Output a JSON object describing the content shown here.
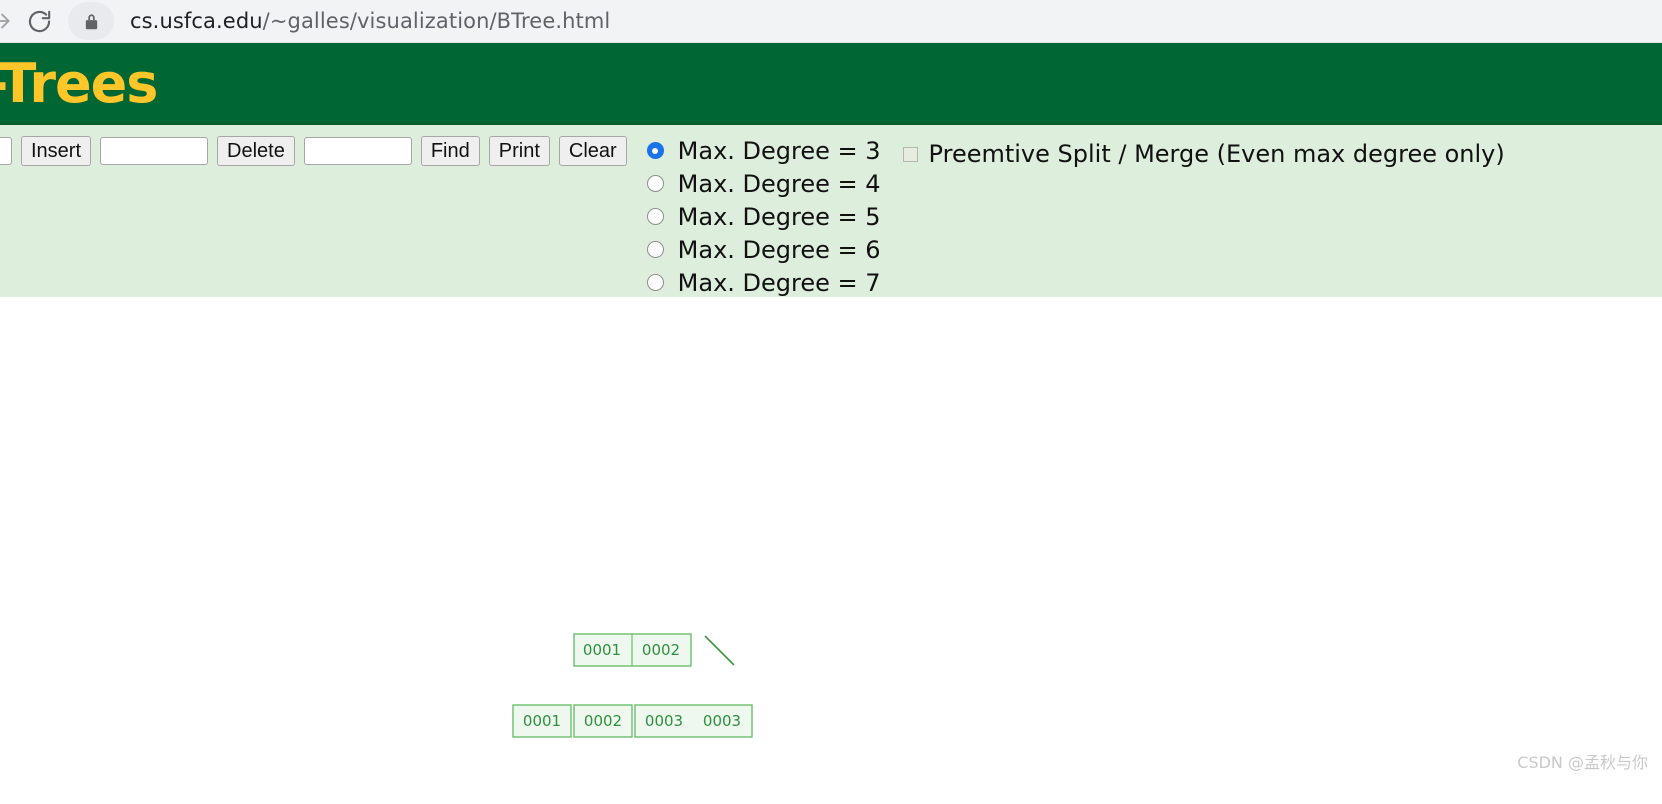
{
  "browser": {
    "forward_icon": "arrow-forward-icon",
    "reload_icon": "reload-icon",
    "lock_icon": "lock-icon",
    "url_host": "cs.usfca.edu",
    "url_path": "/~galles/visualization/BTree.html",
    "url_full": "cs.usfca.edu/~galles/visualization/BTree.html"
  },
  "page": {
    "title": "-Trees",
    "title_color": "#ffc629",
    "banner_color": "#006633",
    "controls_bg": "#ddeedd"
  },
  "toolbar": {
    "insert_value": "",
    "insert_placeholder": "",
    "insert_label": "Insert",
    "delete_value": "",
    "delete_placeholder": "",
    "delete_label": "Delete",
    "find_value": "",
    "find_placeholder": "",
    "find_label": "Find",
    "print_label": "Print",
    "clear_label": "Clear"
  },
  "degree_options": [
    {
      "label": "Max. Degree = 3",
      "value": 3,
      "checked": true
    },
    {
      "label": "Max. Degree = 4",
      "value": 4,
      "checked": false
    },
    {
      "label": "Max. Degree = 5",
      "value": 5,
      "checked": false
    },
    {
      "label": "Max. Degree = 6",
      "value": 6,
      "checked": false
    },
    {
      "label": "Max. Degree = 7",
      "value": 7,
      "checked": false
    }
  ],
  "preemptive": {
    "label": "Preemtive Split / Merge (Even max degree only)",
    "checked": false
  },
  "tree": {
    "node_stroke": "#6cbf6c",
    "node_fill": "#eef8ee",
    "text_color": "#2f8f3f",
    "edge_color": "#3a9a3a",
    "root": {
      "keys": [
        "0001",
        "0002"
      ]
    },
    "leaves": [
      {
        "keys": [
          "0001"
        ]
      },
      {
        "keys": [
          "0002"
        ]
      },
      {
        "keys": [
          "0003",
          "0003"
        ]
      }
    ]
  },
  "watermark": "CSDN @孟秋与你"
}
